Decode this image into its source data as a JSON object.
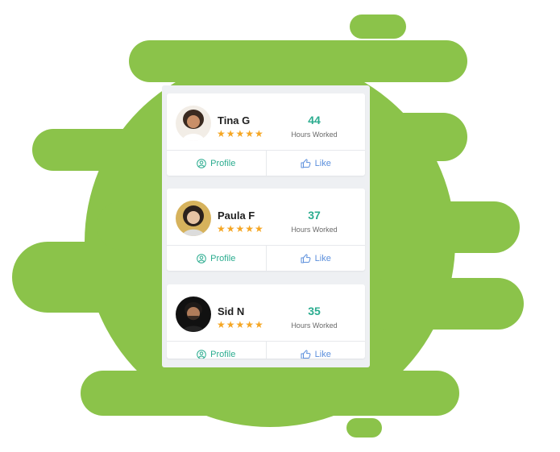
{
  "colors": {
    "blob": "#8bc34a",
    "accent_green": "#2bac8f",
    "like_blue": "#5b8fdc",
    "star": "#f5a623"
  },
  "workers": [
    {
      "name": "Tina G",
      "rating": 5,
      "stars": "★★★★★",
      "hours": "44",
      "hours_label": "Hours Worked",
      "profile_label": "Profile",
      "like_label": "Like"
    },
    {
      "name": "Paula F",
      "rating": 5,
      "stars": "★★★★★",
      "hours": "37",
      "hours_label": "Hours Worked",
      "profile_label": "Profile",
      "like_label": "Like"
    },
    {
      "name": "Sid N",
      "rating": 5,
      "stars": "★★★★★",
      "hours": "35",
      "hours_label": "Hours Worked",
      "profile_label": "Profile",
      "like_label": "Like"
    }
  ]
}
